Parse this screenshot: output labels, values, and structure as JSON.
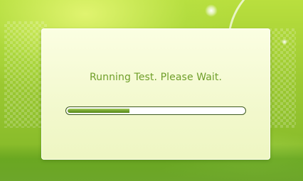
{
  "dialog": {
    "message": "Running Test. Please Wait."
  },
  "progress": {
    "fraction": 0.35
  },
  "colors": {
    "background": "#9cc931",
    "dialog": "#f3f9cf",
    "message_text": "#6f9f2a",
    "progress_fill": "#6f9f2a",
    "progress_border": "#3e5a1f"
  }
}
